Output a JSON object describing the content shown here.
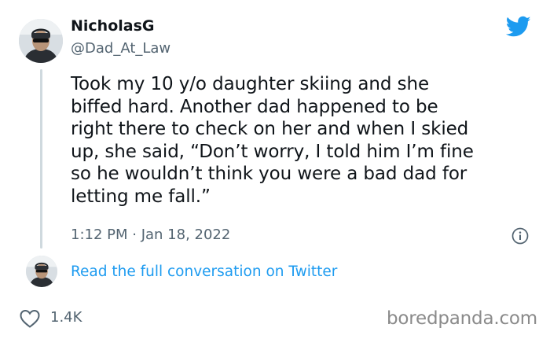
{
  "author": {
    "display_name": "NicholasG",
    "handle": "@Dad_At_Law"
  },
  "tweet": {
    "text": "Took my 10 y/o daughter skiing and she\nbiffed hard. Another dad happened to be\nright there to check on her and when I skied\nup, she said, “Don’t worry, I told him I’m fine\nso he wouldn’t think you were a bad dad for\nletting me fall.”",
    "timestamp": "1:12 PM · Jan 18, 2022",
    "likes": "1.4K"
  },
  "conversation_link": "Read the full conversation on Twitter",
  "watermark": "boredpanda.com",
  "icons": {
    "brand": "twitter-bird-icon",
    "info": "info-icon",
    "like": "heart-icon"
  },
  "colors": {
    "twitter_blue": "#1d9bf0",
    "secondary_text": "#536471",
    "primary_text": "#0f1419",
    "thread_line": "#cfd9de"
  }
}
